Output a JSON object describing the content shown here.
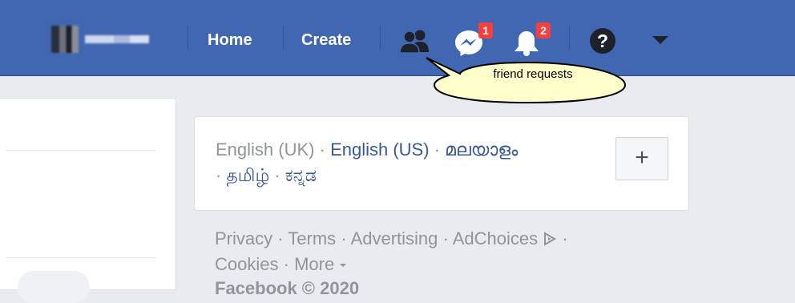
{
  "topbar": {
    "profile": {
      "avatar_icon": "user-avatar-pixelated",
      "name": ""
    },
    "nav": {
      "home_label": "Home",
      "create_label": "Create"
    },
    "icons": {
      "friends": "friends-icon",
      "messenger": "messenger-icon",
      "notifications": "bell-icon",
      "help": "help-icon",
      "menu": "dropdown-arrow-icon"
    },
    "badges": {
      "messenger_count": "1",
      "notifications_count": "2"
    }
  },
  "callout": {
    "text": "friend requests"
  },
  "language_card": {
    "languages": {
      "uk": "English (UK)",
      "us": "English (US)",
      "malayalam": "മലയാളം",
      "tamil": "தமிழ்",
      "kannada": "ಕನ್ನಡ"
    },
    "separator": "·",
    "add_label": "+"
  },
  "footer": {
    "links": {
      "privacy": "Privacy",
      "terms": "Terms",
      "advertising": "Advertising",
      "adchoices": "AdChoices",
      "cookies": "Cookies",
      "more": "More"
    },
    "adchoices_icon": "adchoices-icon",
    "more_icon": "caret-down-icon",
    "separator": "·",
    "copyright": "Facebook © 2020"
  },
  "colors": {
    "topbar": "#4267b2",
    "page_bg": "#e9ebee",
    "link": "#385898",
    "muted_text": "#90949c",
    "badge": "#fa3e3e",
    "callout_fill": "#ffffcc"
  }
}
